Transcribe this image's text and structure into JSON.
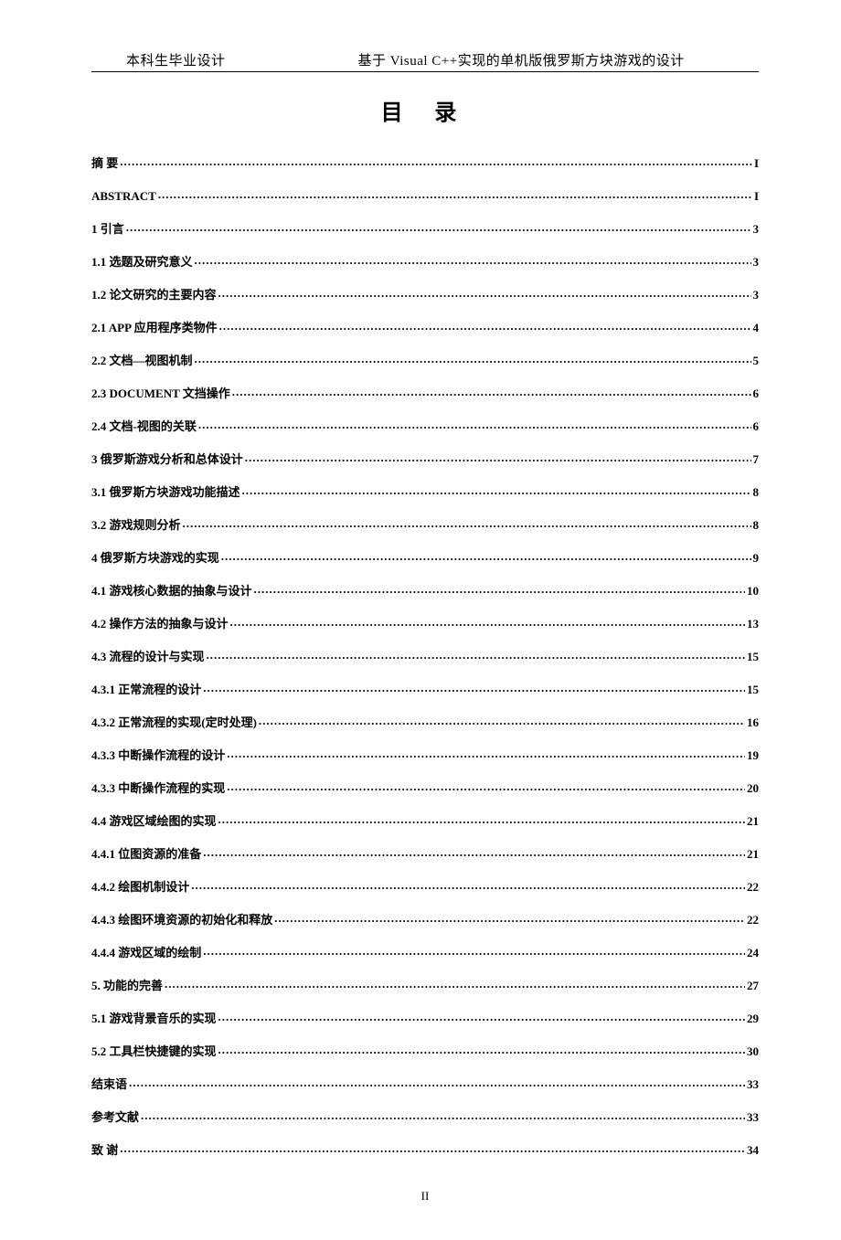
{
  "header": {
    "left": "本科生毕业设计",
    "right": "基于 Visual C++实现的单机版俄罗斯方块游戏的设计"
  },
  "toc_title": "目 录",
  "toc": [
    {
      "label": "摘  要",
      "page": "I"
    },
    {
      "label": "ABSTRACT",
      "page": "I"
    },
    {
      "label": "1 引言",
      "page": "3"
    },
    {
      "label": "1.1 选题及研究意义",
      "page": "3"
    },
    {
      "label": "1.2 论文研究的主要内容",
      "page": "3"
    },
    {
      "label": "2.1 APP 应用程序类物件",
      "page": "4"
    },
    {
      "label": "2.2 文档—视图机制",
      "page": "5"
    },
    {
      "label": "2.3 DOCUMENT 文挡操作",
      "page": "6"
    },
    {
      "label": "2.4 文档-视图的关联",
      "page": "6"
    },
    {
      "label": "3 俄罗斯游戏分析和总体设计",
      "page": "7"
    },
    {
      "label": "3.1 俄罗斯方块游戏功能描述",
      "page": "8"
    },
    {
      "label": "3.2 游戏规则分析",
      "page": "8"
    },
    {
      "label": "4 俄罗斯方块游戏的实现",
      "page": "9"
    },
    {
      "label": "4.1 游戏核心数据的抽象与设计",
      "page": "10"
    },
    {
      "label": "4.2 操作方法的抽象与设计",
      "page": "13"
    },
    {
      "label": "4.3 流程的设计与实现",
      "page": "15"
    },
    {
      "label": "4.3.1 正常流程的设计",
      "page": "15"
    },
    {
      "label": "4.3.2 正常流程的实现(定时处理)",
      "page": "16"
    },
    {
      "label": "4.3.3 中断操作流程的设计",
      "page": "19"
    },
    {
      "label": "4.3.3 中断操作流程的实现",
      "page": "20"
    },
    {
      "label": "4.4 游戏区域绘图的实现",
      "page": "21"
    },
    {
      "label": "4.4.1 位图资源的准备",
      "page": "21"
    },
    {
      "label": "4.4.2 绘图机制设计",
      "page": "22"
    },
    {
      "label": "4.4.3 绘图环境资源的初始化和释放",
      "page": "22"
    },
    {
      "label": "4.4.4 游戏区域的绘制",
      "page": "24"
    },
    {
      "label": "5. 功能的完善",
      "page": "27"
    },
    {
      "label": "5.1 游戏背景音乐的实现",
      "page": "29"
    },
    {
      "label": "5.2 工具栏快捷键的实现",
      "page": "30"
    },
    {
      "label": "结束语",
      "page": "33"
    },
    {
      "label": "参考文献",
      "page": "33"
    },
    {
      "label": "致  谢",
      "page": "34"
    }
  ],
  "footer": "II"
}
